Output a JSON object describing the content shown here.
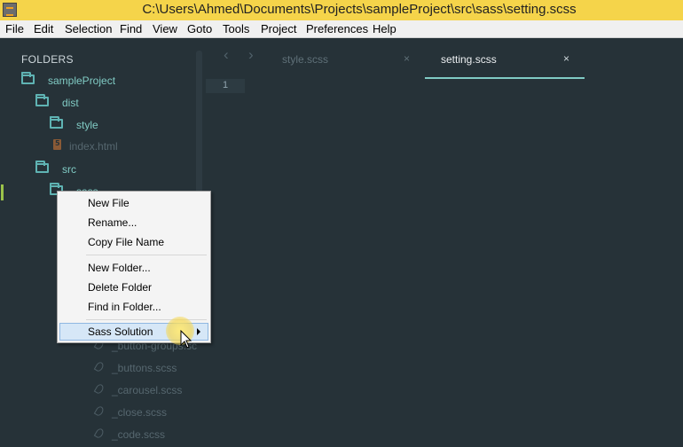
{
  "window": {
    "title": "C:\\Users\\Ahmed\\Documents\\Projects\\sampleProject\\src\\sass\\setting.scss"
  },
  "menu": [
    {
      "label": "File"
    },
    {
      "label": "Edit"
    },
    {
      "label": "Selection"
    },
    {
      "label": "Find"
    },
    {
      "label": "View"
    },
    {
      "label": "Goto"
    },
    {
      "label": "Tools"
    },
    {
      "label": "Project"
    },
    {
      "label": "Preferences"
    },
    {
      "label": "Help"
    }
  ],
  "sidebar": {
    "heading": "FOLDERS",
    "tree": {
      "project": "sampleProject",
      "dist": "dist",
      "style": "style",
      "index_html": "index.html",
      "src": "src",
      "sass_partial": "sass",
      "files": [
        "_button-groups.sc",
        "_buttons.scss",
        "_carousel.scss",
        "_close.scss",
        "_code.scss"
      ]
    }
  },
  "tabs": [
    {
      "label": "style.scss",
      "close": "×",
      "active": false
    },
    {
      "label": "setting.scss",
      "close": "×",
      "active": true
    }
  ],
  "nav": {
    "back": "‹",
    "forward": "›"
  },
  "editor": {
    "line_number": "1"
  },
  "context_menu": {
    "items": [
      {
        "label": "New File"
      },
      {
        "label": "Rename..."
      },
      {
        "label": "Copy File Name"
      },
      {
        "label": "New Folder..."
      },
      {
        "label": "Delete Folder"
      },
      {
        "label": "Find in Folder..."
      },
      {
        "label": "Sass Solution"
      }
    ]
  },
  "colors": {
    "title_bar": "#f5d44a",
    "background": "#263238",
    "accent": "#80cbc4",
    "menu_highlight": "#d6e7f7"
  }
}
